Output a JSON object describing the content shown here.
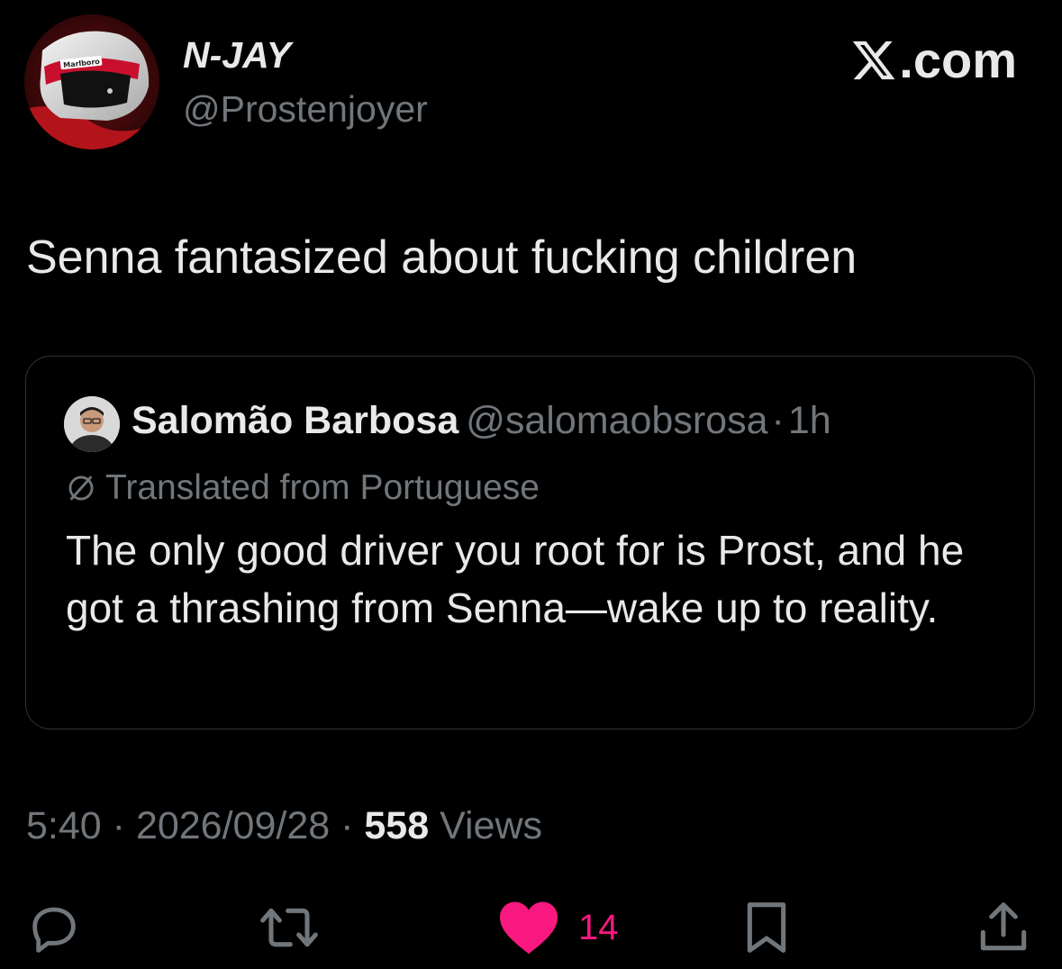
{
  "brand": {
    "label": ".com",
    "icon": "x-logo-icon"
  },
  "author": {
    "name": "N-JAY",
    "handle": "@Prostenjoyer",
    "avatar_icon": "racing-helmet-avatar",
    "avatar_logo_text": "Marlboro"
  },
  "tweet": {
    "text": "Senna fantasized about fucking children"
  },
  "quote": {
    "name": "Salomão Barbosa",
    "handle": "@salomaobsrosa",
    "separator": "·",
    "time": "1h",
    "translated_label": "Translated from Portuguese",
    "translated_icon": "globe-icon",
    "body": "The only good driver you root for is Prost, and he got a thrashing from Senna—wake up to reality."
  },
  "meta": {
    "time": "5:40",
    "sep1": "·",
    "date": "2026/09/28",
    "sep2": "·",
    "views_count": "558",
    "views_label": "Views"
  },
  "actions": {
    "reply_icon": "reply-icon",
    "retweet_icon": "retweet-icon",
    "like_icon": "heart-icon",
    "like_count": "14",
    "bookmark_icon": "bookmark-icon",
    "share_icon": "share-icon"
  },
  "colors": {
    "background": "#000000",
    "text_primary": "#e7e9ea",
    "text_secondary": "#71767b",
    "like_pink": "#f91880",
    "border": "#2f3336"
  }
}
